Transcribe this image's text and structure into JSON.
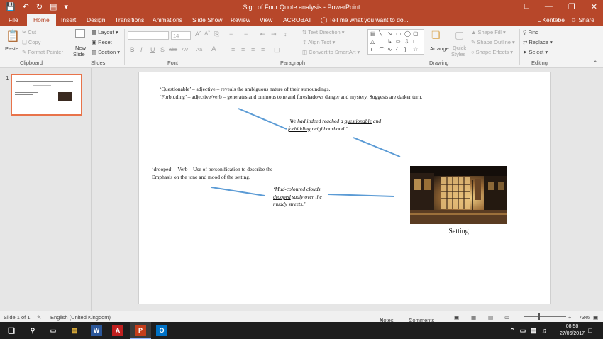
{
  "app": {
    "title": "Sign of Four Quote analysis - PowerPoint",
    "user": "L Kentebe",
    "share": "Share",
    "tell_me": "Tell me what you want to do...",
    "accent": "#b7472a"
  },
  "tabs": [
    "File",
    "Home",
    "Insert",
    "Design",
    "Transitions",
    "Animations",
    "Slide Show",
    "Review",
    "View",
    "ACROBAT"
  ],
  "active_tab": "Home",
  "ribbon": {
    "clipboard": {
      "paste": "Paste",
      "cut": "Cut",
      "copy": "Copy",
      "format_painter": "Format Painter",
      "label": "Clipboard"
    },
    "slides": {
      "new_slide": "New",
      "new_slide2": "Slide",
      "layout": "Layout",
      "reset": "Reset",
      "section": "Section",
      "label": "Slides"
    },
    "font": {
      "font_name": "",
      "font_size": "14",
      "bold": "B",
      "italic": "I",
      "underline": "U",
      "strike": "S",
      "shadow": "abc",
      "spacing": "AV",
      "case": "Aa",
      "color": "A",
      "label": "Font"
    },
    "paragraph": {
      "text_direction": "Text Direction",
      "align_text": "Align Text",
      "convert_smartart": "Convert to SmartArt",
      "label": "Paragraph"
    },
    "drawing": {
      "arrange": "Arrange",
      "quick_styles": "Quick",
      "quick_styles2": "Styles",
      "shape_fill": "Shape Fill",
      "shape_outline": "Shape Outline",
      "shape_effects": "Shape Effects",
      "label": "Drawing"
    },
    "editing": {
      "find": "Find",
      "replace": "Replace",
      "select": "Select",
      "label": "Editing"
    }
  },
  "thumbnail": {
    "number": "1"
  },
  "slide": {
    "line1": "‘Questionable’ – adjective – reveals the ambiguous nature of their surroundings.",
    "line2": "‘Forbidding’ – adjective/verb – generates and ominous tone and foreshadows danger and mystery. Suggests are darker turn.",
    "quote1_a": "‘We had indeed reached a ",
    "quote1_u1": "questionable",
    "quote1_b": " and",
    "quote1_u2": "forbidding",
    "quote1_c": " neighbourhood.’",
    "drooped_line1": "‘drooped’ – Verb – Use of personification to describe the",
    "drooped_line2": "Emphasis on the tone and mood of the setting.",
    "quote2_a": "‘Mud-coloured clouds",
    "quote2_u": "drooped",
    "quote2_b": " sadly over the",
    "quote2_c": "muddy streets.’",
    "caption": "Setting"
  },
  "statusbar": {
    "slide_count": "Slide 1 of 1",
    "language": "English (United Kingdom)",
    "notes": "Notes",
    "comments": "Comments",
    "zoom": "73%"
  },
  "taskbar": {
    "time": "08:58",
    "date": "27/06/2017"
  }
}
